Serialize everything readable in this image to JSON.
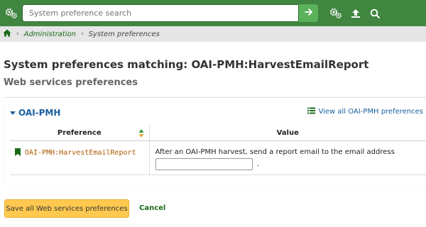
{
  "topbar": {
    "background": "#408540",
    "search_placeholder": "System preference search",
    "icons": [
      "cogs-icon",
      "arrow-right-icon",
      "cogs-icon",
      "upload-icon",
      "search-icon"
    ]
  },
  "breadcrumb": {
    "home_icon": "home-icon",
    "administration": "Administration",
    "current": "System preferences"
  },
  "page": {
    "title": "System preferences matching: OAI-PMH:HarvestEmailReport",
    "subtitle": "Web services preferences"
  },
  "section": {
    "title": "OAI-PMH",
    "view_all": "View all OAI-PMH preferences",
    "table": {
      "headers": [
        "Preference",
        "Value"
      ],
      "rows": [
        {
          "name": "OAI-PMH:HarvestEmailReport",
          "description": "After an OAI-PMH harvest, send a report email to the email address",
          "input_value": "",
          "suffix": "."
        }
      ]
    }
  },
  "actions": {
    "save_label": "Save all Web services preferences",
    "cancel_label": "Cancel"
  },
  "colors": {
    "accent": "#408540",
    "link": "#1a5f9e",
    "save_button": "#ffc84e",
    "pref_name": "#b05800"
  }
}
